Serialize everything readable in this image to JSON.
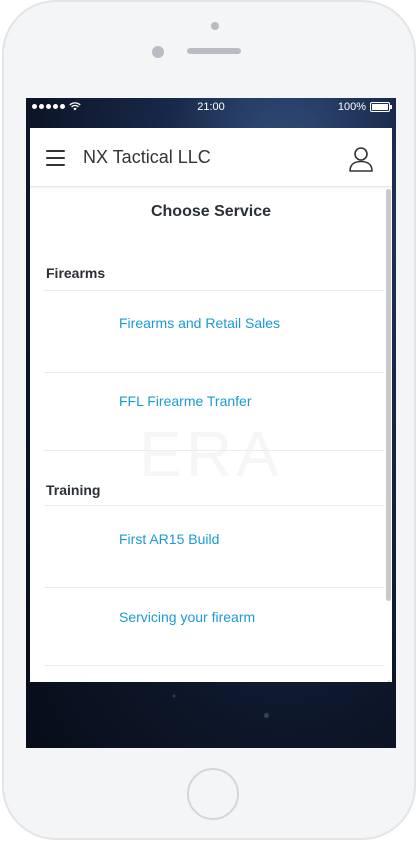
{
  "statusbar": {
    "time": "21:00",
    "battery": "100%"
  },
  "header": {
    "app_title": "NX Tactical LLC"
  },
  "page": {
    "title": "Choose Service"
  },
  "sections": [
    {
      "title": "Firearms",
      "items": [
        "Firearms and Retail Sales",
        "FFL Firearme Tranfer"
      ]
    },
    {
      "title": "Training",
      "items": [
        "First AR15 Build",
        "Servicing your firearm"
      ]
    }
  ],
  "background": {
    "watermark": "ERA"
  },
  "icons": [
    "signal-dots-icon",
    "wifi-icon",
    "battery-icon",
    "hamburger-menu-icon",
    "user-profile-icon"
  ],
  "colors": {
    "link": "#1a9ad6",
    "heading": "#2b2f36",
    "screen_bg": "#0d1628"
  }
}
